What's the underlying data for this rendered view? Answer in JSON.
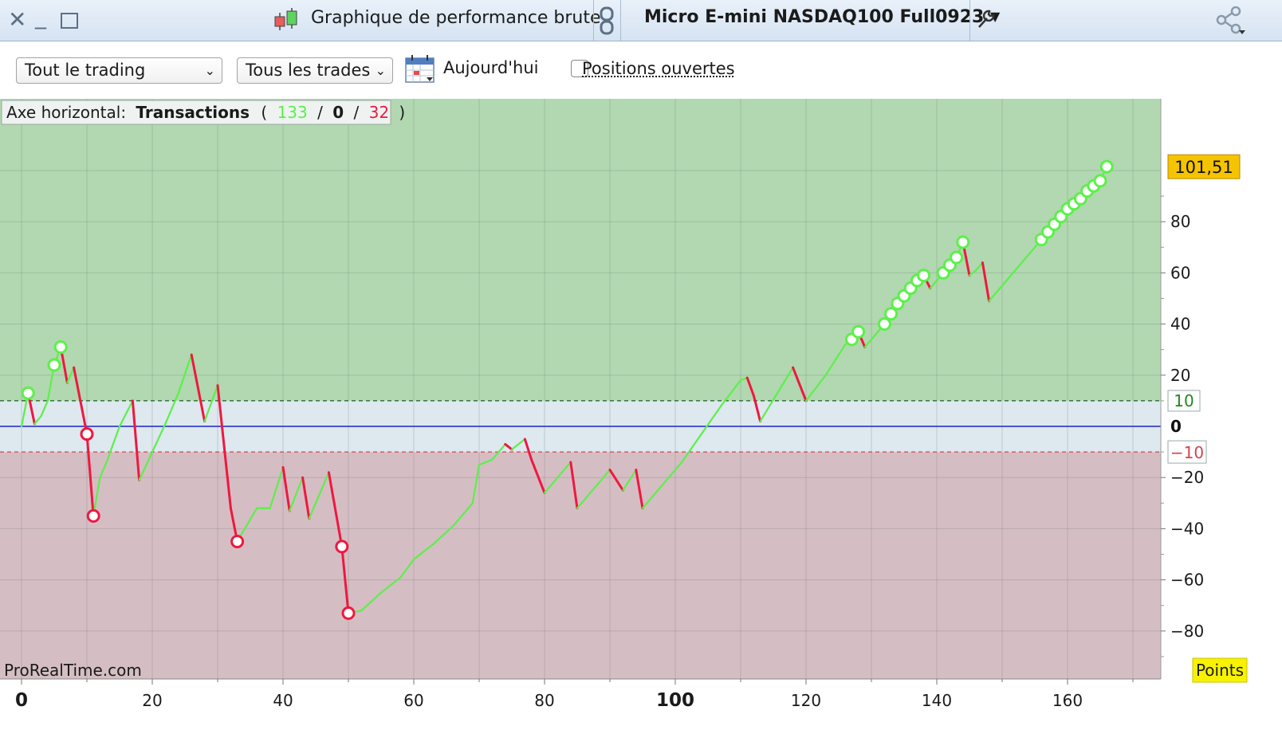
{
  "window": {
    "title": "Graphique de performance brute",
    "instrument": "Micro E-mini NASDAQ100 Full0923"
  },
  "toolbar": {
    "scope_select": "Tout le trading",
    "trades_select": "Tous les trades",
    "today_label": "Aujourd'hui",
    "open_positions_label": "Positions ouvertes",
    "open_positions_checked": false
  },
  "header_box": {
    "prefix": "Axe horizontal:",
    "mode": "Transactions",
    "wins": "133",
    "neutral": "0",
    "losses": "32"
  },
  "watermark": "ProRealTime.com",
  "units_badge": "Points",
  "colors": {
    "gain": "#5cf04a",
    "loss": "#f0173f",
    "positive_zone": "#b1d8b0",
    "negative_zone": "#d4bec3",
    "neutral_zone": "#dde8ef",
    "zero_line": "#1d22c8",
    "last_value_badge": "#f5c400"
  },
  "chart_data": {
    "type": "line",
    "title": "",
    "xlabel": "",
    "ylabel": "",
    "xlim": [
      -3,
      175
    ],
    "ylim": [
      -90,
      105
    ],
    "x_ticks": [
      0,
      20,
      40,
      60,
      80,
      100,
      120,
      140,
      160
    ],
    "y_ticks": [
      -80,
      -60,
      -40,
      -20,
      20,
      40,
      60,
      80
    ],
    "threshold_upper": {
      "value": 10,
      "label": "10"
    },
    "threshold_lower": {
      "value": -10,
      "label": "-10"
    },
    "zero_label": "0",
    "last_value": {
      "value": 101.51,
      "label": "101,51"
    },
    "points": [
      [
        0,
        0
      ],
      [
        1,
        13
      ],
      [
        2,
        1
      ],
      [
        3,
        4
      ],
      [
        4,
        10
      ],
      [
        5,
        24
      ],
      [
        6,
        31
      ],
      [
        7,
        17
      ],
      [
        8,
        23
      ],
      [
        10,
        -3
      ],
      [
        11,
        -35
      ],
      [
        12,
        -20
      ],
      [
        13,
        -14
      ],
      [
        15,
        0
      ],
      [
        17,
        10
      ],
      [
        18,
        -21
      ],
      [
        20,
        -10
      ],
      [
        22,
        1
      ],
      [
        24,
        13
      ],
      [
        26,
        28
      ],
      [
        28,
        2
      ],
      [
        30,
        16
      ],
      [
        32,
        -32
      ],
      [
        33,
        -45
      ],
      [
        36,
        -32
      ],
      [
        38,
        -32
      ],
      [
        40,
        -16
      ],
      [
        41,
        -33
      ],
      [
        43,
        -20
      ],
      [
        44,
        -36
      ],
      [
        47,
        -18
      ],
      [
        49,
        -47
      ],
      [
        50,
        -73
      ],
      [
        52,
        -72
      ],
      [
        55,
        -65
      ],
      [
        58,
        -59
      ],
      [
        60,
        -52
      ],
      [
        63,
        -46
      ],
      [
        66,
        -39
      ],
      [
        69,
        -30
      ],
      [
        70,
        -15
      ],
      [
        72,
        -13
      ],
      [
        74,
        -7
      ],
      [
        75,
        -9
      ],
      [
        77,
        -5
      ],
      [
        78,
        -13
      ],
      [
        80,
        -26
      ],
      [
        84,
        -14
      ],
      [
        85,
        -32
      ],
      [
        90,
        -17
      ],
      [
        92,
        -25
      ],
      [
        94,
        -17
      ],
      [
        95,
        -32
      ],
      [
        98,
        -23
      ],
      [
        101,
        -14
      ],
      [
        104,
        -3
      ],
      [
        107,
        8
      ],
      [
        110,
        18
      ],
      [
        111,
        19
      ],
      [
        112,
        12
      ],
      [
        113,
        2
      ],
      [
        118,
        23
      ],
      [
        120,
        10
      ],
      [
        123,
        20
      ],
      [
        126,
        32
      ],
      [
        127,
        34
      ],
      [
        128,
        37
      ],
      [
        129,
        31
      ],
      [
        132,
        40
      ],
      [
        133,
        44
      ],
      [
        134,
        48
      ],
      [
        135,
        51
      ],
      [
        136,
        54
      ],
      [
        137,
        57
      ],
      [
        138,
        59
      ],
      [
        139,
        54
      ],
      [
        141,
        60
      ],
      [
        142,
        63
      ],
      [
        143,
        66
      ],
      [
        144,
        72
      ],
      [
        145,
        59
      ],
      [
        146,
        61
      ],
      [
        147,
        64
      ],
      [
        148,
        49
      ],
      [
        152,
        61
      ],
      [
        156,
        73
      ],
      [
        157,
        76
      ],
      [
        158,
        79
      ],
      [
        159,
        82
      ],
      [
        160,
        85
      ],
      [
        161,
        87
      ],
      [
        162,
        89
      ],
      [
        163,
        92
      ],
      [
        164,
        94
      ],
      [
        165,
        96
      ],
      [
        166,
        101.51
      ]
    ],
    "markers": [
      {
        "x": 1,
        "y": 13,
        "type": "high"
      },
      {
        "x": 5,
        "y": 24,
        "type": "high"
      },
      {
        "x": 6,
        "y": 31,
        "type": "high"
      },
      {
        "x": 10,
        "y": -3,
        "type": "low"
      },
      {
        "x": 11,
        "y": -35,
        "type": "low"
      },
      {
        "x": 33,
        "y": -45,
        "type": "low"
      },
      {
        "x": 49,
        "y": -47,
        "type": "low"
      },
      {
        "x": 50,
        "y": -73,
        "type": "low"
      },
      {
        "x": 127,
        "y": 34,
        "type": "high"
      },
      {
        "x": 128,
        "y": 37,
        "type": "high"
      },
      {
        "x": 132,
        "y": 40,
        "type": "high"
      },
      {
        "x": 133,
        "y": 44,
        "type": "high"
      },
      {
        "x": 134,
        "y": 48,
        "type": "high"
      },
      {
        "x": 135,
        "y": 51,
        "type": "high"
      },
      {
        "x": 136,
        "y": 54,
        "type": "high"
      },
      {
        "x": 137,
        "y": 57,
        "type": "high"
      },
      {
        "x": 138,
        "y": 59,
        "type": "high"
      },
      {
        "x": 141,
        "y": 60,
        "type": "high"
      },
      {
        "x": 142,
        "y": 63,
        "type": "high"
      },
      {
        "x": 143,
        "y": 66,
        "type": "high"
      },
      {
        "x": 144,
        "y": 72,
        "type": "high"
      },
      {
        "x": 156,
        "y": 73,
        "type": "high"
      },
      {
        "x": 157,
        "y": 76,
        "type": "high"
      },
      {
        "x": 158,
        "y": 79,
        "type": "high"
      },
      {
        "x": 159,
        "y": 82,
        "type": "high"
      },
      {
        "x": 160,
        "y": 85,
        "type": "high"
      },
      {
        "x": 161,
        "y": 87,
        "type": "high"
      },
      {
        "x": 162,
        "y": 89,
        "type": "high"
      },
      {
        "x": 163,
        "y": 92,
        "type": "high"
      },
      {
        "x": 164,
        "y": 94,
        "type": "high"
      },
      {
        "x": 165,
        "y": 96,
        "type": "high"
      },
      {
        "x": 166,
        "y": 101.51,
        "type": "high"
      }
    ]
  }
}
